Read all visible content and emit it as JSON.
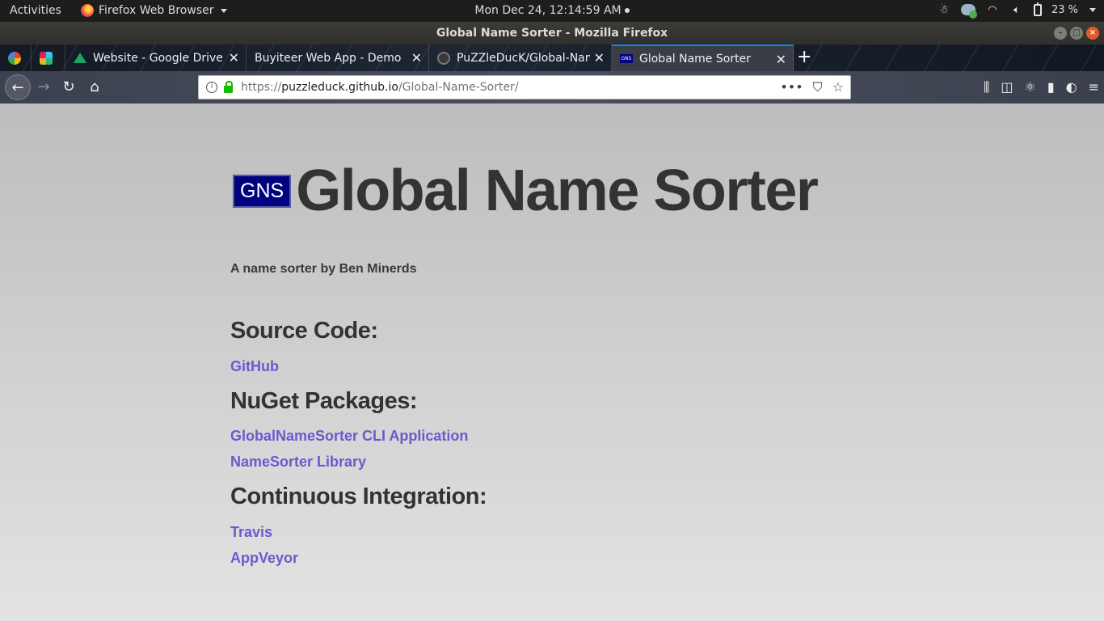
{
  "system": {
    "activities": "Activities",
    "app_name": "Firefox Web Browser",
    "clock": "Mon Dec 24, 12:14:59 AM",
    "battery": "23 %"
  },
  "window": {
    "title": "Global Name Sorter - Mozilla Firefox"
  },
  "tabs": [
    {
      "label": ""
    },
    {
      "label": ""
    },
    {
      "label": "Website - Google Drive"
    },
    {
      "label": "Buyiteer Web App - Demo"
    },
    {
      "label": "PuZZleDucK/Global-Nam"
    },
    {
      "label": "Global Name Sorter"
    }
  ],
  "navbar": {
    "url_domain_prefix": "https://",
    "url_domain": "puzzleduck.github.io",
    "url_path": "/Global-Name-Sorter/"
  },
  "page": {
    "logo_text": "GNS",
    "title": "Global Name Sorter",
    "tagline": "A name sorter by Ben Minerds",
    "sections": [
      {
        "heading": "Source Code:",
        "links": [
          "GitHub"
        ]
      },
      {
        "heading": "NuGet Packages:",
        "links": [
          "GlobalNameSorter CLI Application",
          "NameSorter Library"
        ]
      },
      {
        "heading": "Continuous Integration:",
        "links": [
          "Travis",
          "AppVeyor"
        ]
      }
    ]
  }
}
